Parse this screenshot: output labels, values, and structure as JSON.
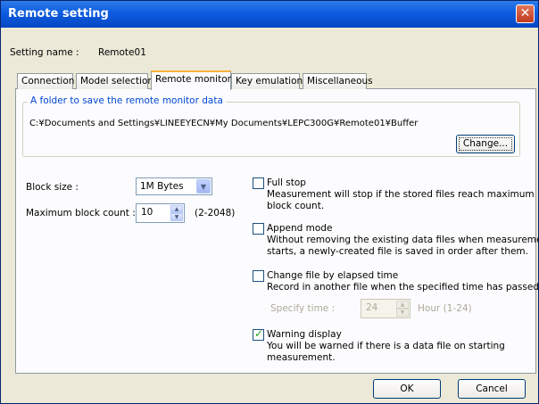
{
  "window": {
    "title": "Remote setting",
    "close_glyph": "✕"
  },
  "setting_name": {
    "label": "Setting name :",
    "value": "Remote01"
  },
  "tabs": [
    {
      "label": "Connection"
    },
    {
      "label": "Model selection"
    },
    {
      "label": "Remote monitor"
    },
    {
      "label": "Key emulation"
    },
    {
      "label": "Miscellaneous"
    }
  ],
  "folder": {
    "title": "A folder to save the remote monitor data",
    "path": "C:¥Documents and Settings¥LINEEYECN¥My Documents¥LEPC300G¥Remote01¥Buffer",
    "change_label": "Change..."
  },
  "block_size": {
    "label": "Block size :",
    "value": "1M Bytes"
  },
  "max_block": {
    "label": "Maximum block count :",
    "value": "10",
    "range": "(2-2048)"
  },
  "options": {
    "full_stop": {
      "checked": false,
      "label": "Full stop",
      "desc1": "Measurement will stop if the stored files reach maximum",
      "desc2": "block count."
    },
    "append": {
      "checked": false,
      "label": "Append mode",
      "desc1": "Without removing the existing data files when measurement",
      "desc2": "starts, a newly-created file is saved in order after them."
    },
    "change_file": {
      "checked": false,
      "label": "Change file by elapsed time",
      "desc1": "Record in another file when the specified time has passed.",
      "specify_label": "Specify time :",
      "time_value": "24",
      "hour_label": "Hour (1-24)"
    },
    "warning": {
      "checked": true,
      "label": "Warning display",
      "desc1": "You will be warned if there is a data file on starting",
      "desc2": "measurement."
    }
  },
  "buttons": {
    "ok": "OK",
    "cancel": "Cancel"
  },
  "icons": {
    "dropdown": "chevron-down-icon",
    "spin_up": "spin-up-icon",
    "spin_down": "spin-down-icon"
  }
}
